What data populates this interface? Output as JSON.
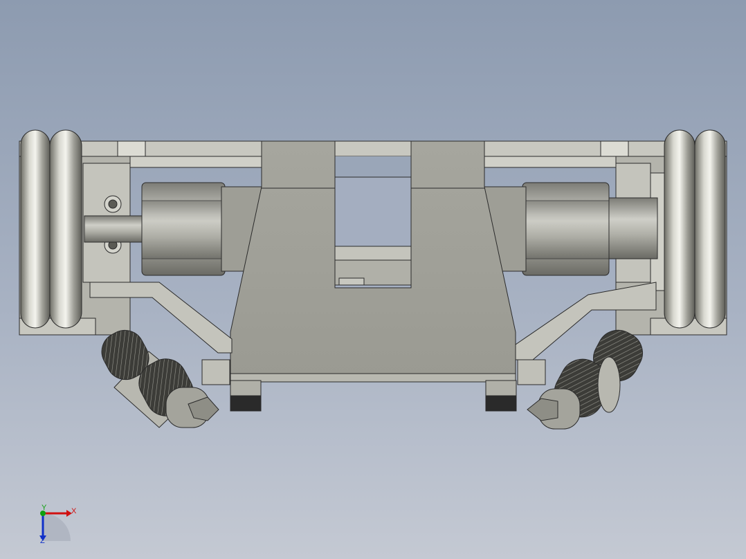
{
  "triad": {
    "x_label": "X",
    "y_label": "Y",
    "z_label": "Z",
    "x_color": "#d01010",
    "y_color": "#10a010",
    "z_color": "#1030c8"
  },
  "model": {
    "shade_light": "#e2e2dc",
    "shade_mid": "#b8b8b0",
    "shade_dark": "#8c8c84",
    "edge": "#2a2a2a"
  }
}
